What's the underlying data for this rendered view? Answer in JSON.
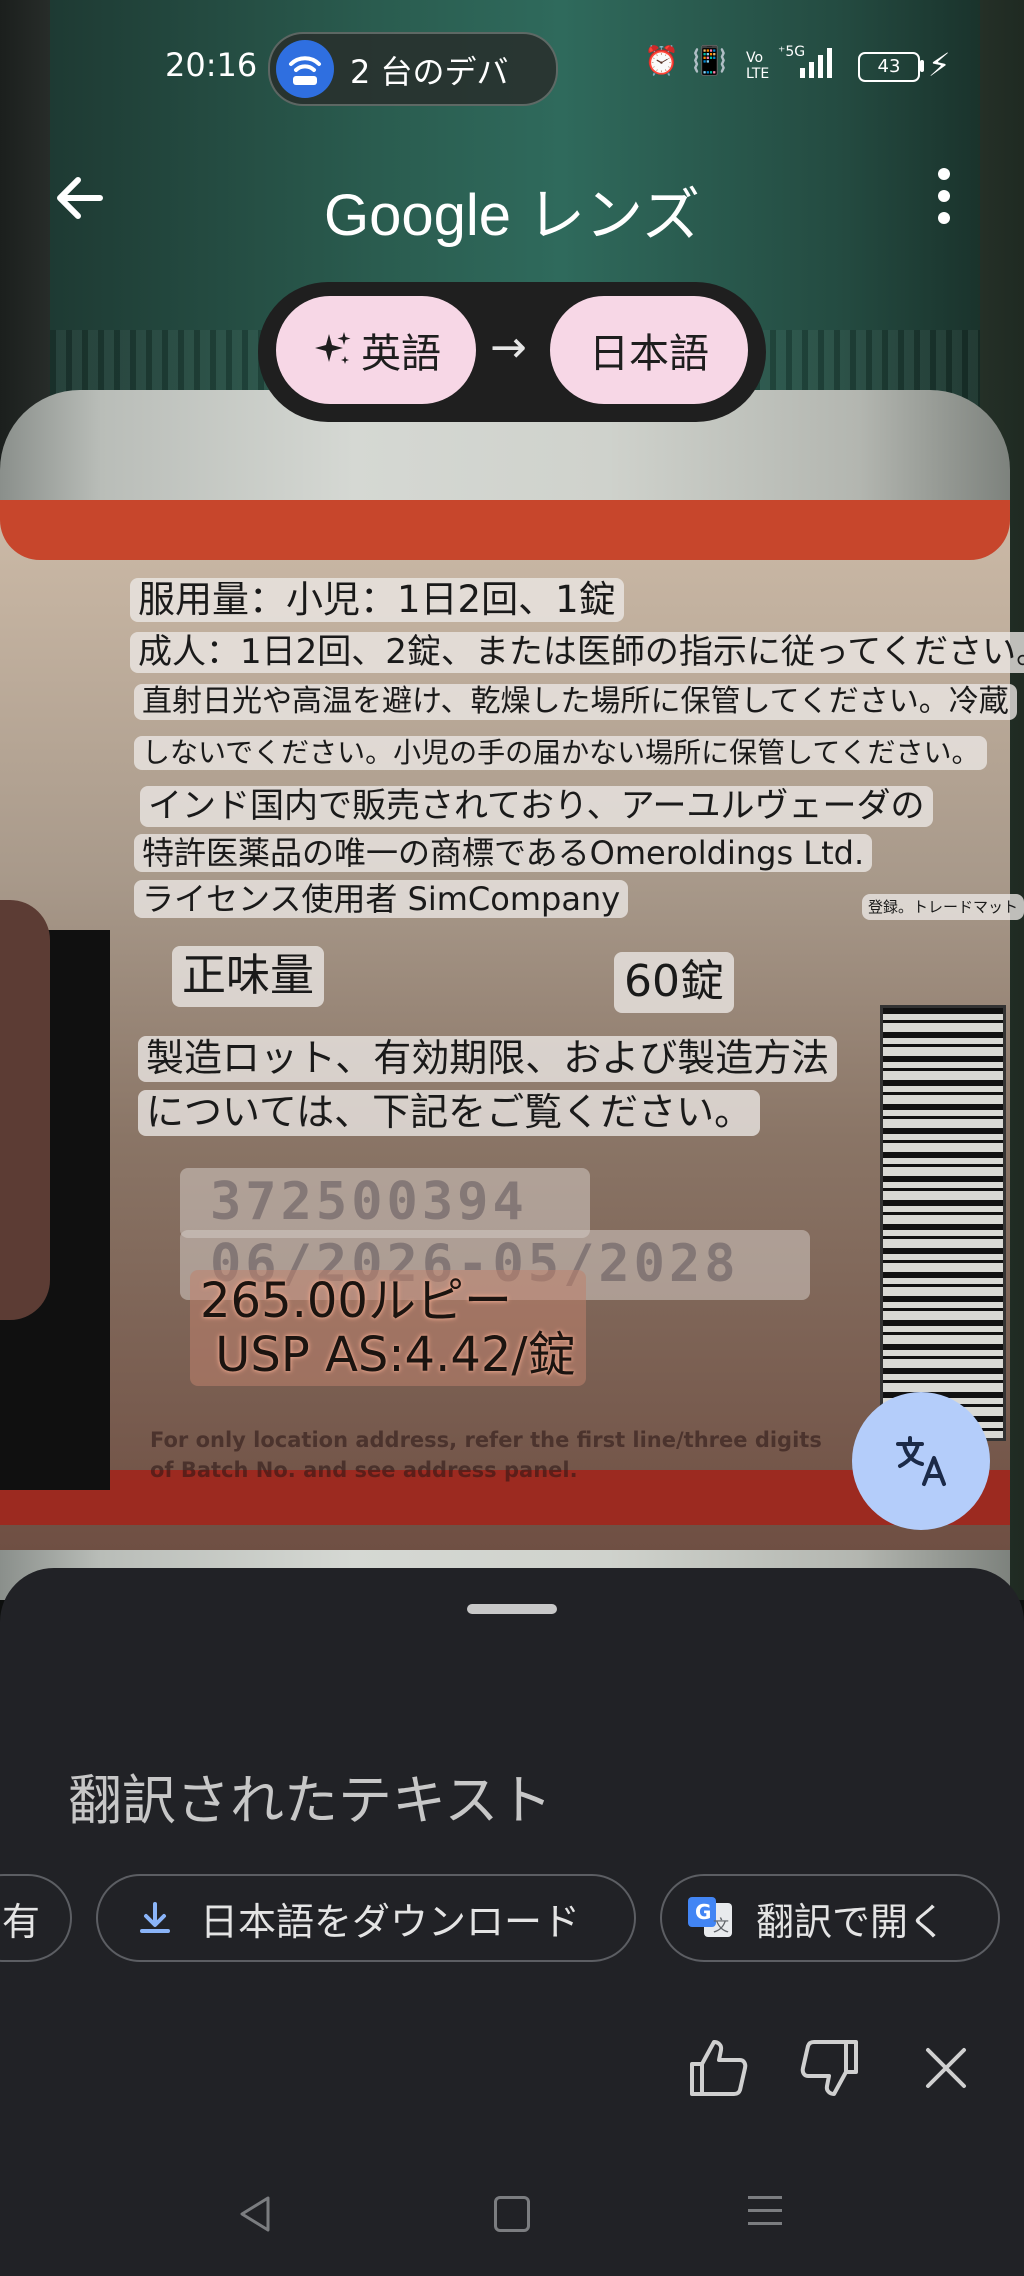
{
  "status_bar": {
    "time": "20:16",
    "hotspot_text": "2 台のデバ",
    "battery": "43"
  },
  "header": {
    "title": "Google レンズ"
  },
  "language": {
    "source": "英語",
    "target": "日本語"
  },
  "translations": {
    "dosage_1": "服用量：小児：1日2回、1錠",
    "dosage_2": "成人：1日2回、2錠、または医師の指示に従ってください。",
    "storage_1": "直射日光や高温を避け、乾燥した場所に保管してください。冷蔵",
    "storage_2": "しないでください。小児の手の届かない場所に保管してください。",
    "sale_1": "インド国内で販売されており、アーユルヴェーダの",
    "sale_2": "特許医薬品の唯一の商標であるOmeroldings Ltd.",
    "sale_3": "ライセンス使用者 SimCompany",
    "trademark": "登録。トレードマット",
    "net_label": "正味量",
    "net_value": "60錠",
    "lot_1": "製造ロット、有効期限、および製造方法",
    "lot_2": "については、下記をご覧ください。",
    "price": "265.00ルピー\n USP AS:4.42/錠"
  },
  "camera_text": {
    "lot_number": "372500394",
    "expiry": "06/2026-05/2028",
    "fine_print": "For only location address, refer the first line/three digits of Batch No. and see address panel."
  },
  "sheet": {
    "title": "翻訳されたテキスト",
    "share_label": "有",
    "download_label": "日本語をダウンロード",
    "open_translate_label": "翻訳で開く"
  },
  "colors": {
    "chip_pink": "#f7d7e6",
    "fab_blue": "#b4cdfa",
    "sheet_bg": "#212226"
  }
}
